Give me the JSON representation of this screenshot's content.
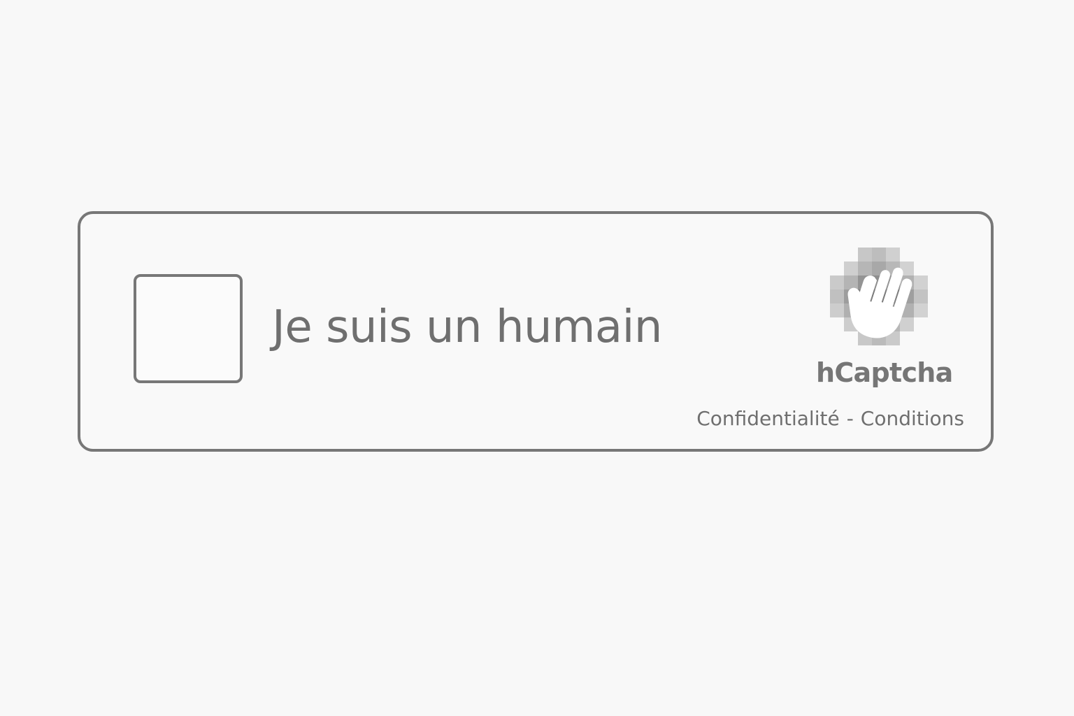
{
  "captcha": {
    "checkbox_label": "Je suis un humain",
    "brand_name": "hCaptcha",
    "logo_icon": "hcaptcha-hand-logo-icon",
    "links": {
      "privacy": "Confidentialité",
      "separator": "-",
      "terms": "Conditions"
    }
  },
  "colors": {
    "background": "#f8f8f8",
    "border": "#777777",
    "text": "#6f6f6f",
    "logo_light": "#d6d6d6",
    "logo_mid": "#a9a9a9",
    "logo_dark": "#7d7d7d"
  }
}
